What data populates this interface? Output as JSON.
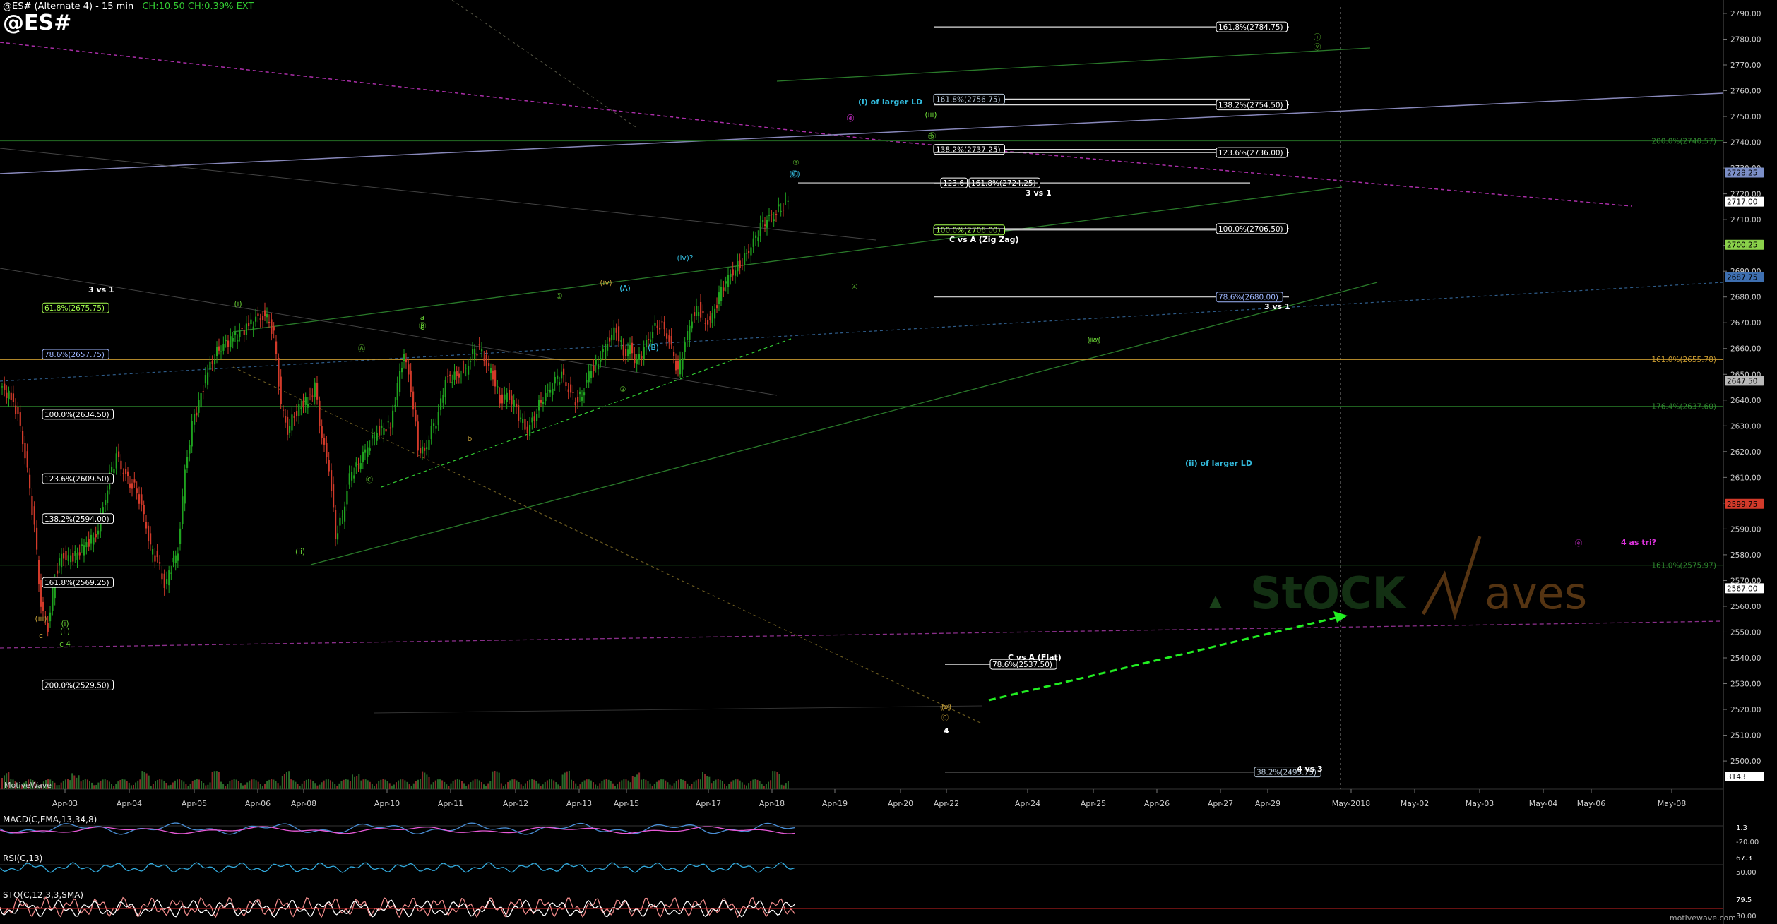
{
  "header": {
    "title": "@ES# (Alternate 4) - 15 min",
    "stats": "CH:10.50  CH:0.39%  EXT",
    "symbol": "@ES#"
  },
  "watermark": {
    "brand_left": "StOCK",
    "brand_right": "aves"
  },
  "footer": {
    "left": "MotiveWave",
    "right": "motivewave.com"
  },
  "colors": {
    "bg": "#000000",
    "up": "#1fa31f",
    "down": "#d23a2a",
    "green_count": "#66cc33",
    "cyan_count": "#33bbdd",
    "magenta": "#dd33dd",
    "fib_gold": "#c8a23a"
  },
  "price_axis": {
    "labels": [
      "2790.00",
      "2780.00",
      "2770.00",
      "2760.00",
      "2750.00",
      "2740.00",
      "2730.00",
      "2720.00",
      "2710.00",
      "2700.00",
      "2690.00",
      "2680.00",
      "2670.00",
      "2660.00",
      "2650.00",
      "2640.00",
      "2630.00",
      "2620.00",
      "2610.00",
      "2600.00",
      "2590.00",
      "2580.00",
      "2570.00",
      "2560.00",
      "2550.00",
      "2540.00",
      "2530.00",
      "2520.00",
      "2510.00",
      "2500.00"
    ],
    "tags": [
      {
        "text": "2728.25",
        "value": 2728.25,
        "color": "#7c8fc8"
      },
      {
        "text": "2717.00",
        "value": 2717.0,
        "color": "#ffffff"
      },
      {
        "text": "2700.25",
        "value": 2700.25,
        "color": "#8ad04a"
      },
      {
        "text": "2687.75",
        "value": 2687.75,
        "color": "#3e6fb0"
      },
      {
        "text": "2647.50",
        "value": 2647.5,
        "color": "#b8b8b8"
      },
      {
        "text": "2599.75",
        "value": 2599.75,
        "color": "#d23a2a"
      },
      {
        "text": "2567.00",
        "value": 2567.0,
        "color": "#ffffff"
      },
      {
        "text": "3143",
        "value": 2494.0,
        "color": "#ffffff"
      }
    ]
  },
  "date_axis": [
    "Apr-03",
    "Apr-04",
    "Apr-05",
    "Apr-06",
    "Apr-08",
    "Apr-10",
    "Apr-11",
    "Apr-12",
    "Apr-13",
    "Apr-15",
    "Apr-17",
    "Apr-18",
    "Apr-19",
    "Apr-20",
    "Apr-22",
    "Apr-24",
    "Apr-25",
    "Apr-26",
    "Apr-27",
    "Apr-29",
    "May-2018",
    "May-02",
    "May-03",
    "May-04",
    "May-06",
    "May-08"
  ],
  "chart_data": {
    "type": "candlestick",
    "title": "@ES# (Alternate 4) - 15 min",
    "interval": "15 min",
    "ylim": [
      2494,
      2793
    ],
    "close_path": [
      [
        0,
        2645
      ],
      [
        2,
        2640
      ],
      [
        3,
        2630
      ],
      [
        4,
        2612
      ],
      [
        5,
        2590
      ],
      [
        6,
        2560
      ],
      [
        7,
        2552
      ],
      [
        8,
        2572
      ],
      [
        9,
        2580
      ],
      [
        10,
        2578
      ],
      [
        12,
        2582
      ],
      [
        14,
        2588
      ],
      [
        15,
        2598
      ],
      [
        16,
        2610
      ],
      [
        17,
        2618
      ],
      [
        18,
        2612
      ],
      [
        19,
        2608
      ],
      [
        20,
        2605
      ],
      [
        21,
        2595
      ],
      [
        22,
        2582
      ],
      [
        23,
        2578
      ],
      [
        24,
        2568
      ],
      [
        26,
        2582
      ],
      [
        27,
        2612
      ],
      [
        28,
        2630
      ],
      [
        30,
        2648
      ],
      [
        31,
        2656
      ],
      [
        32,
        2660
      ],
      [
        34,
        2664
      ],
      [
        36,
        2668
      ],
      [
        38,
        2673
      ],
      [
        39,
        2672
      ],
      [
        40,
        2665
      ],
      [
        41,
        2638
      ],
      [
        42,
        2628
      ],
      [
        43,
        2635
      ],
      [
        45,
        2640
      ],
      [
        46,
        2645
      ],
      [
        47,
        2625
      ],
      [
        48,
        2614
      ],
      [
        49,
        2588
      ],
      [
        50,
        2595
      ],
      [
        51,
        2610
      ],
      [
        53,
        2618
      ],
      [
        55,
        2628
      ],
      [
        57,
        2630
      ],
      [
        58,
        2645
      ],
      [
        59,
        2658
      ],
      [
        60,
        2645
      ],
      [
        61,
        2622
      ],
      [
        62,
        2620
      ],
      [
        63,
        2628
      ],
      [
        64,
        2634
      ],
      [
        65,
        2648
      ],
      [
        67,
        2650
      ],
      [
        68,
        2652
      ],
      [
        69,
        2658
      ],
      [
        70,
        2660
      ],
      [
        71,
        2654
      ],
      [
        72,
        2650
      ],
      [
        73,
        2640
      ],
      [
        74,
        2642
      ],
      [
        75,
        2638
      ],
      [
        76,
        2632
      ],
      [
        77,
        2628
      ],
      [
        78,
        2634
      ],
      [
        79,
        2640
      ],
      [
        80,
        2643
      ],
      [
        81,
        2647
      ],
      [
        82,
        2650
      ],
      [
        83,
        2644
      ],
      [
        84,
        2640
      ],
      [
        85,
        2642
      ],
      [
        86,
        2650
      ],
      [
        88,
        2658
      ],
      [
        89,
        2664
      ],
      [
        90,
        2668
      ],
      [
        91,
        2658
      ],
      [
        92,
        2660
      ],
      [
        93,
        2654
      ],
      [
        94,
        2660
      ],
      [
        95,
        2665
      ],
      [
        96,
        2670
      ],
      [
        97,
        2668
      ],
      [
        98,
        2660
      ],
      [
        99,
        2650
      ],
      [
        100,
        2662
      ],
      [
        101,
        2672
      ],
      [
        102,
        2676
      ],
      [
        103,
        2670
      ],
      [
        104,
        2672
      ],
      [
        105,
        2680
      ],
      [
        106,
        2686
      ],
      [
        107,
        2690
      ],
      [
        108,
        2693
      ],
      [
        109,
        2697
      ],
      [
        110,
        2701
      ],
      [
        111,
        2707
      ],
      [
        112,
        2710
      ],
      [
        113,
        2712
      ],
      [
        114,
        2715
      ],
      [
        115,
        2717
      ]
    ],
    "annotations": [
      {
        "price": 2784.75,
        "label": "161.8%(2784.75)"
      },
      {
        "price": 2756.75,
        "label": "161.8%(2756.75)"
      },
      {
        "price": 2754.5,
        "label": "138.2%(2754.50)"
      },
      {
        "price": 2737.25,
        "label": "138.2%(2737.25)"
      },
      {
        "price": 2736.0,
        "label": "123.6%(2736.00)"
      },
      {
        "price": 2724.25,
        "label": "161.8%(2724.25)"
      },
      {
        "price": 2706.0,
        "label": "100.0%(2706.00)"
      },
      {
        "price": 2706.5,
        "label": "100.0%(2706.50)"
      },
      {
        "price": 2680.0,
        "label": "78.6%(2680.00)"
      },
      {
        "price": 2675.75,
        "label": "61.8%(2675.75)"
      },
      {
        "price": 2657.75,
        "label": "78.6%(2657.75)"
      },
      {
        "price": 2634.5,
        "label": "100.0%(2634.50)"
      },
      {
        "price": 2609.5,
        "label": "123.6%(2609.50)"
      },
      {
        "price": 2594.0,
        "label": "138.2%(2594.00)"
      },
      {
        "price": 2569.25,
        "label": "161.8%(2569.25)"
      },
      {
        "price": 2537.5,
        "label": "78.6%(2537.50)"
      },
      {
        "price": 2529.5,
        "label": "200.0%(2529.50)"
      },
      {
        "price": 2495.75,
        "label": "38.2%(2495.75)"
      },
      {
        "price": 2740.57,
        "label": "200.0%(2740.57)"
      },
      {
        "price": 2655.78,
        "label": "161.0%(2655.78)"
      },
      {
        "price": 2637.6,
        "label": "176.4%(2637.60)"
      },
      {
        "price": 2575.97,
        "label": "161.0%(2575.97)"
      }
    ],
    "notes": [
      "3 vs 1",
      "C vs A (Zig Zag)",
      "C vs A (Flat)",
      "4 vs 3",
      "(i) of larger LD",
      "(ii) of larger LD",
      "4 as tri?"
    ]
  },
  "indicators": {
    "macd": {
      "label": "MACD(C,EMA,13,34,8)",
      "ticks": [
        "1.3",
        "-20.00"
      ]
    },
    "rsi": {
      "label": "RSI(C,13)",
      "ticks": [
        "67.3",
        "50.00"
      ]
    },
    "stoch": {
      "label": "STO(C,12,3,3,SMA)",
      "ticks": [
        "79.5",
        "30.00"
      ]
    }
  },
  "labels_text": {
    "fib_left": [
      "61.8%(2675.75)",
      "78.6%(2657.75)",
      "100.0%(2634.50)",
      "123.6%(2609.50)",
      "138.2%(2594.00)",
      "161.8%(2569.25)",
      "200.0%(2529.50)"
    ],
    "fib_mid_top": [
      "161.8%(2756.75)",
      "138.2%(2737.25)",
      "123.6",
      "161.8%(2724.25)",
      "100.0%(2706.00)"
    ],
    "fib_right": [
      "161.8%(2784.75)",
      "138.2%(2754.50)",
      "123.6%(2736.00)",
      "100.0%(2706.50)",
      "78.6%(2680.00)"
    ],
    "fib_lower": [
      "78.6%(2537.50)",
      "38.2%(2495.75)"
    ],
    "fib_gold_right": [
      "200.0%(2740.57)",
      "161.0%(2655.78)",
      "176.4%(2637.60)",
      "161.0%(2575.97)"
    ],
    "texts": [
      "3 vs 1",
      "3 vs 1",
      "3 vs 1",
      "C vs A (Zig Zag)",
      "C vs A (Flat)",
      "4 vs 3",
      "(i) of larger LD",
      "(ii) of larger LD",
      "4 as tri?",
      "4"
    ],
    "counts": [
      "(i)",
      "(ii)",
      "(iii)",
      "(iv)",
      "(v)",
      "ⓘ",
      "ⓥ",
      "(iii)",
      "(iv)",
      "c",
      "(ii)",
      "(i)",
      "c 4",
      "a",
      "b",
      "c",
      "(A)",
      "(B)",
      "(C)",
      "(iv)?",
      "(v)",
      "Ⓒ",
      "(A)",
      "(B)",
      "Ⓐ",
      "Ⓑ",
      "Ⓒ",
      "①",
      "②",
      "③",
      "④",
      "⑤",
      "(iii)",
      "(iv)",
      "ⓐ",
      "ⓑ",
      "ⓒ",
      "ⓓ",
      "ⓔ"
    ]
  }
}
